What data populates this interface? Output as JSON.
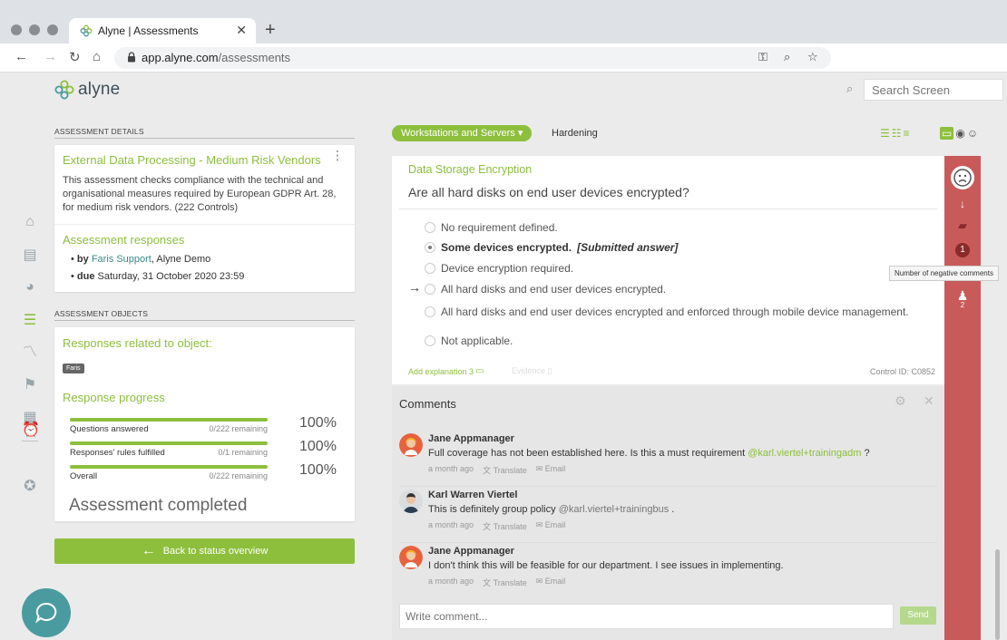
{
  "browser": {
    "tab_title": "Alyne | Assessments",
    "new_tab": "+",
    "url_host": "app.alyne.com",
    "url_path": "/assessments"
  },
  "app": {
    "logo_text": "alyne",
    "search_placeholder": "Search Screen"
  },
  "colors": {
    "brand_green": "#8dbf3c",
    "alert_red": "#c85a5a",
    "chat_teal": "#4a9b9f"
  },
  "details": {
    "section_label": "ASSESSMENT DETAILS",
    "title": "External Data Processing - Medium Risk Vendors",
    "description": "This assessment checks compliance with the technical and organisational measures required by European GDPR Art. 28, for medium risk vendors. (222 Controls)",
    "responses_title": "Assessment responses",
    "by_label": "by",
    "by_user": "Faris Support",
    "by_org": ", Alyne Demo",
    "due_label": "due",
    "due_date": "Saturday, 31 October 2020 23:59"
  },
  "objects": {
    "section_label": "ASSESSMENT OBJECTS",
    "related_title": "Responses related to object:",
    "tag": "Faris",
    "progress_title": "Response progress",
    "progress": [
      {
        "label": "Questions answered",
        "remaining": "0/222 remaining",
        "pct": "100%",
        "fill": 1.0
      },
      {
        "label": "Responses' rules fulfilled",
        "remaining": "0/1 remaining",
        "pct": "100%",
        "fill": 1.0
      },
      {
        "label": "Overall",
        "remaining": "0/222 remaining",
        "pct": "100%",
        "fill": 1.0
      }
    ],
    "completed": "Assessment completed"
  },
  "back_button": "Back to status overview",
  "main": {
    "category_pill": "Workstations and Servers",
    "breadcrumb": "Hardening",
    "question_title": "Data Storage Encryption",
    "question_text": "Are all hard disks on end user devices encrypted?",
    "options": [
      {
        "label": "No requirement defined.",
        "selected": false
      },
      {
        "label": "Some devices encrypted.",
        "suffix": "[Submitted answer]",
        "selected": true
      },
      {
        "label": "Device encryption required.",
        "selected": false
      },
      {
        "label": "All hard disks and end user devices encrypted.",
        "selected": false,
        "arrow": true
      },
      {
        "label": "All hard disks and end user devices encrypted and enforced through mobile device management.",
        "selected": false
      },
      {
        "label": "Not applicable.",
        "selected": false
      }
    ],
    "add_explanation": "Add explanation 3",
    "evidence": "Evidence",
    "control_id": "Control ID: C0852"
  },
  "comments": {
    "title": "Comments",
    "items": [
      {
        "name": "Jane Appmanager",
        "text": "Full coverage has not been established here. Is this a must requirement ",
        "mention": "@karl.viertel+trainingadm",
        "text_after": " ?",
        "time": "a month ago",
        "translate": "Translate",
        "email": "Email"
      },
      {
        "name": "Karl Warren Viertel",
        "text": "This is definitely group policy ",
        "mention": "@karl.viertel+trainingbus",
        "text_after": " .",
        "time": "a month ago",
        "translate": "Translate",
        "email": "Email"
      },
      {
        "name": "Jane Appmanager",
        "text": "I don't think this will be feasible for our department. I see issues in implementing.",
        "mention": "",
        "text_after": "",
        "time": "a month ago",
        "translate": "Translate",
        "email": "Email"
      }
    ],
    "input_placeholder": "Write comment...",
    "send": "Send"
  },
  "sidebar_right": {
    "negative_count": "1",
    "person_count": "2",
    "tooltip": "Number of negative comments"
  }
}
